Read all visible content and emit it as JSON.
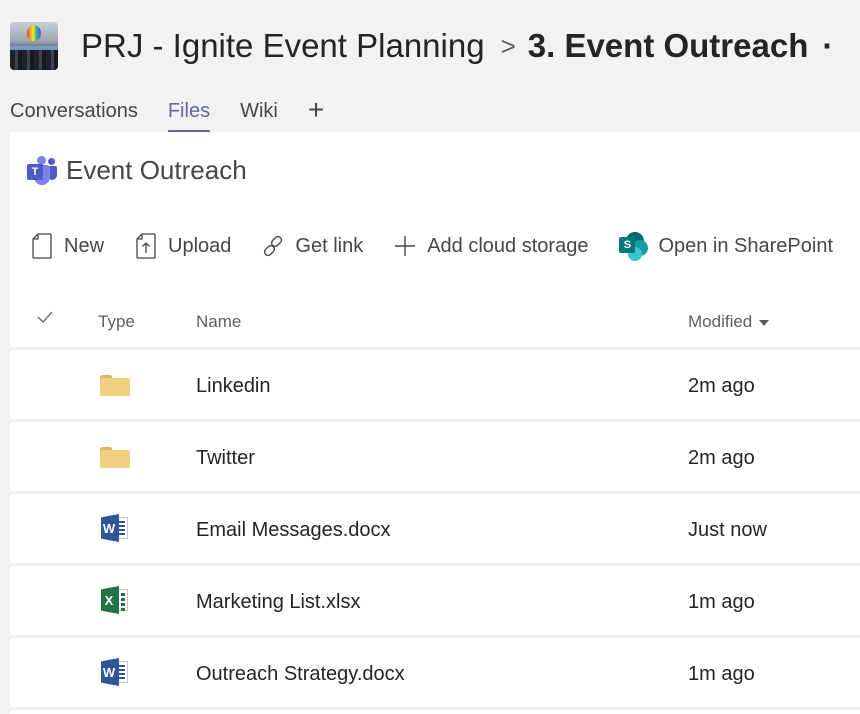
{
  "header": {
    "team_avatar": "team-photo",
    "team_name": "PRJ - Ignite Event Planning",
    "separator": ">",
    "channel_name": "3. Event Outreach",
    "more": "·"
  },
  "tabs": [
    {
      "label": "Conversations",
      "active": false
    },
    {
      "label": "Files",
      "active": true
    },
    {
      "label": "Wiki",
      "active": false
    }
  ],
  "add_tab_label": "+",
  "panel": {
    "title": "Event Outreach",
    "title_icon": "teams-icon"
  },
  "toolbar": {
    "new_label": "New",
    "upload_label": "Upload",
    "get_link_label": "Get link",
    "add_cloud_storage_label": "Add cloud storage",
    "open_sharepoint_label": "Open in SharePoint"
  },
  "table": {
    "columns": {
      "select": "✓",
      "type": "Type",
      "name": "Name",
      "modified": "Modified"
    },
    "sort": {
      "column": "Modified",
      "direction": "descending"
    },
    "rows": [
      {
        "type": "folder",
        "name": "Linkedin",
        "modified": "2m ago"
      },
      {
        "type": "folder",
        "name": "Twitter",
        "modified": "2m ago"
      },
      {
        "type": "word",
        "name": "Email Messages.docx",
        "modified": "Just now"
      },
      {
        "type": "excel",
        "name": "Marketing List.xlsx",
        "modified": "1m ago"
      },
      {
        "type": "word",
        "name": "Outreach Strategy.docx",
        "modified": "1m ago"
      }
    ]
  },
  "colors": {
    "accent": "#6264a7",
    "background": "#f3f2f1",
    "panel": "#ffffff",
    "folder": "#f0cf7e",
    "word": "#2b579a",
    "excel": "#217346",
    "sharepoint": "#036c70"
  }
}
